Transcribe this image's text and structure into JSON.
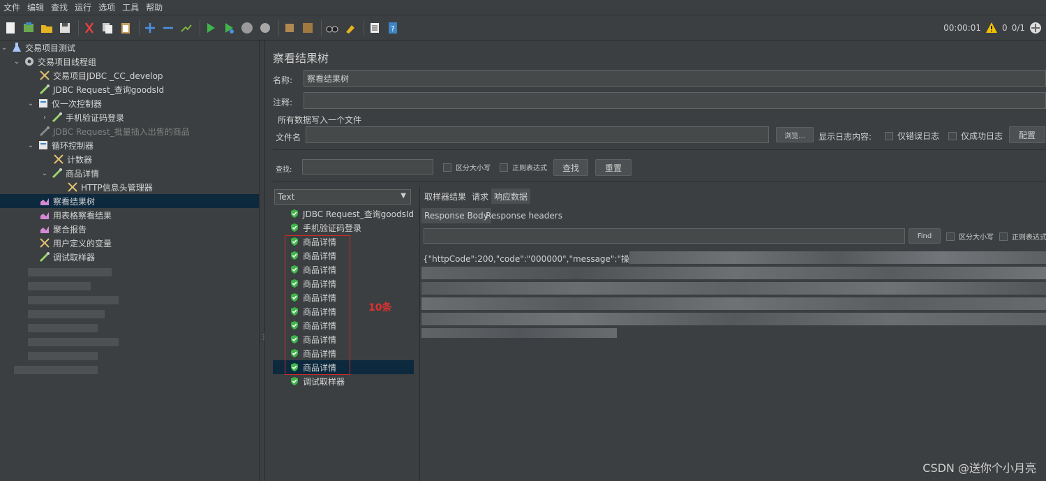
{
  "menu": [
    "文件",
    "编辑",
    "查找",
    "运行",
    "选项",
    "工具",
    "帮助"
  ],
  "toolbar": {
    "timer": "00:00:01",
    "warn_count": "0",
    "threads": "0/1"
  },
  "tree": {
    "items": [
      {
        "label": "交易项目测试",
        "icon": "flask-icon",
        "disabled": false
      },
      {
        "label": "交易项目线程组",
        "icon": "gear-icon",
        "disabled": false
      },
      {
        "label": "交易项目JDBC _CC_develop",
        "icon": "wrench-icon",
        "disabled": false
      },
      {
        "label": "JDBC Request_查询goodsId",
        "icon": "pipette-icon",
        "disabled": false
      },
      {
        "label": "仅一次控制器",
        "icon": "controller-icon",
        "disabled": false
      },
      {
        "label": "手机验证码登录",
        "icon": "pipette-icon",
        "disabled": false
      },
      {
        "label": "JDBC Request_批量插入出售的商品",
        "icon": "pipette-icon",
        "disabled": true
      },
      {
        "label": "循环控制器",
        "icon": "controller-icon",
        "disabled": false
      },
      {
        "label": "计数器",
        "icon": "wrench-icon",
        "disabled": false
      },
      {
        "label": "商品详情",
        "icon": "pipette-icon",
        "disabled": false
      },
      {
        "label": "HTTP信息头管理器",
        "icon": "wrench-icon",
        "disabled": false
      },
      {
        "label": "察看结果树",
        "icon": "chart-icon",
        "disabled": false
      },
      {
        "label": "用表格察看结果",
        "icon": "chart-icon",
        "disabled": false
      },
      {
        "label": "聚合报告",
        "icon": "chart-icon",
        "disabled": false
      },
      {
        "label": "用户定义的变量",
        "icon": "wrench-icon",
        "disabled": false
      },
      {
        "label": "调试取样器",
        "icon": "pipette-icon",
        "disabled": false
      }
    ]
  },
  "panel": {
    "title": "察看结果树",
    "name_label": "名称:",
    "name_value": "察看结果树",
    "comment_label": "注释:",
    "file_group": "所有数据写入一个文件",
    "file_label": "文件名",
    "browse": "浏览...",
    "log_label": "显示日志内容:",
    "errors_only": "仅错误日志",
    "success_only": "仅成功日志",
    "configure": "配置",
    "search_label": "查找:",
    "case_sensitive": "区分大小写",
    "regex": "正则表达式",
    "search_btn": "查找",
    "reset_btn": "重置"
  },
  "results": {
    "render_mode": "Text",
    "items": [
      "JDBC Request_查询goodsId",
      "手机验证码登录",
      "商品详情",
      "商品详情",
      "商品详情",
      "商品详情",
      "商品详情",
      "商品详情",
      "商品详情",
      "商品详情",
      "商品详情",
      "商品详情",
      "调试取样器"
    ],
    "annotation": "10条"
  },
  "response": {
    "tabs": [
      "取样器结果",
      "请求",
      "响应数据"
    ],
    "subtabs": [
      "Response Body",
      "Response headers"
    ],
    "find_btn": "Find",
    "case_sensitive": "区分大小写",
    "regex": "正则表达式",
    "body_text": "{\"httpCode\":200,\"code\":\"000000\",\"message\":\"操作成功\""
  },
  "watermark": "CSDN @送你个小月亮",
  "colors": {
    "success": "#3fb44a",
    "selection": "#0d293e",
    "annotation": "#e03030"
  }
}
